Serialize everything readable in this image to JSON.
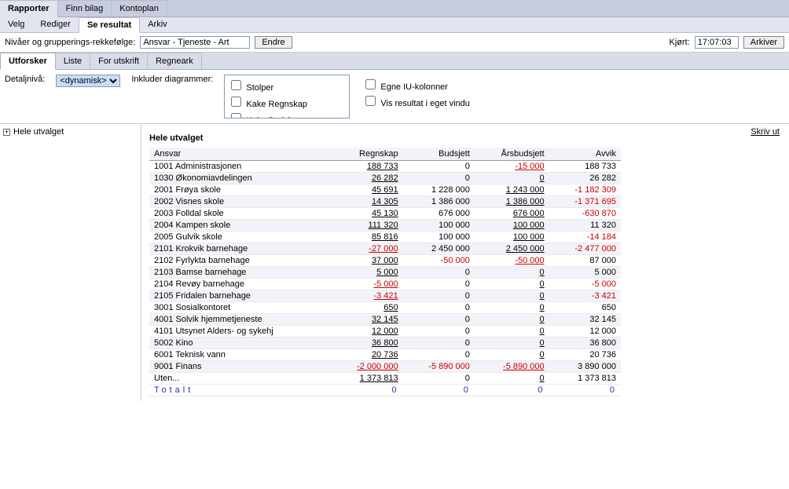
{
  "tabs1": {
    "rapporter": "Rapporter",
    "finnbilag": "Finn bilag",
    "kontoplan": "Kontoplan"
  },
  "tabs2": {
    "velg": "Velg",
    "rediger": "Rediger",
    "seresultat": "Se resultat",
    "arkiv": "Arkiv"
  },
  "toolbar": {
    "label": "Nivåer og grupperings-rekkefølge:",
    "value": "Ansvar - Tjeneste - Art",
    "endre": "Endre",
    "kjort": "Kjørt:",
    "time": "17:07:03",
    "arkiver": "Arkiver"
  },
  "tabs3": {
    "utforsker": "Utforsker",
    "liste": "Liste",
    "forutskrift": "For utskrift",
    "regneark": "Regneark"
  },
  "options": {
    "detaljniva": "Detaljnivå:",
    "dynamisk": "<dynamisk>",
    "inkluder": "Inkluder diagrammer:",
    "stolper": "Stolper",
    "kakeRegnskap": "Kake Regnskap",
    "kakeBudsjett": "Kake Budsjett",
    "egne": "Egne IU-kolonner",
    "vis": "Vis resultat i eget vindu"
  },
  "tree": {
    "hele": "Hele utvalget"
  },
  "print": "Skriv ut",
  "section": "Hele utvalget",
  "columns": {
    "ansvar": "Ansvar",
    "regnskap": "Regnskap",
    "budsjett": "Budsjett",
    "aarsbudsjett": "Årsbudsjett",
    "avvik": "Avvik"
  },
  "rows": [
    {
      "ansvar": "1001 Administrasjonen",
      "regnskap": "188 733",
      "rneg": false,
      "budsjett": "0",
      "aars": "-15 000",
      "aneg": true,
      "avvik": "188 733",
      "vneg": false
    },
    {
      "ansvar": "1030 Økonomiavdelingen",
      "regnskap": "26 282",
      "rneg": false,
      "budsjett": "0",
      "aars": "0",
      "aneg": false,
      "avvik": "26 282",
      "vneg": false
    },
    {
      "ansvar": "2001 Frøya skole",
      "regnskap": "45 691",
      "rneg": false,
      "budsjett": "1 228 000",
      "aars": "1 243 000",
      "aneg": false,
      "avvik": "-1 182 309",
      "vneg": true
    },
    {
      "ansvar": "2002 Visnes skole",
      "regnskap": "14 305",
      "rneg": false,
      "budsjett": "1 386 000",
      "aars": "1 386 000",
      "aneg": false,
      "avvik": "-1 371 695",
      "vneg": true
    },
    {
      "ansvar": "2003 Folldal skole",
      "regnskap": "45 130",
      "rneg": false,
      "budsjett": "676 000",
      "aars": "676 000",
      "aneg": false,
      "avvik": "-630 870",
      "vneg": true
    },
    {
      "ansvar": "2004 Kampen skole",
      "regnskap": "111 320",
      "rneg": false,
      "budsjett": "100 000",
      "aars": "100 000",
      "aneg": false,
      "avvik": "11 320",
      "vneg": false
    },
    {
      "ansvar": "2005 Gulvik skole",
      "regnskap": "85 816",
      "rneg": false,
      "budsjett": "100 000",
      "aars": "100 000",
      "aneg": false,
      "avvik": "-14 184",
      "vneg": true
    },
    {
      "ansvar": "2101 Krokvik barnehage",
      "regnskap": "-27 000",
      "rneg": true,
      "budsjett": "2 450 000",
      "aars": "2 450 000",
      "aneg": false,
      "avvik": "-2 477 000",
      "vneg": true
    },
    {
      "ansvar": "2102 Fyrlykta barnehage",
      "regnskap": "37 000",
      "rneg": false,
      "budsjett": "-50 000",
      "bneg": true,
      "aars": "-50 000",
      "aneg": true,
      "avvik": "87 000",
      "vneg": false
    },
    {
      "ansvar": "2103 Bamse barnehage",
      "regnskap": "5 000",
      "rneg": false,
      "budsjett": "0",
      "aars": "0",
      "aneg": false,
      "avvik": "5 000",
      "vneg": false
    },
    {
      "ansvar": "2104 Revøy barnehage",
      "regnskap": "-5 000",
      "rneg": true,
      "budsjett": "0",
      "aars": "0",
      "aneg": false,
      "avvik": "-5 000",
      "vneg": true
    },
    {
      "ansvar": "2105 Fridalen barnehage",
      "regnskap": "-3 421",
      "rneg": true,
      "budsjett": "0",
      "aars": "0",
      "aneg": false,
      "avvik": "-3 421",
      "vneg": true
    },
    {
      "ansvar": "3001 Sosialkontoret",
      "regnskap": "650",
      "rneg": false,
      "budsjett": "0",
      "aars": "0",
      "aneg": false,
      "avvik": "650",
      "vneg": false
    },
    {
      "ansvar": "4001 Solvik hjemmetjeneste",
      "regnskap": "32 145",
      "rneg": false,
      "budsjett": "0",
      "aars": "0",
      "aneg": false,
      "avvik": "32 145",
      "vneg": false
    },
    {
      "ansvar": "4101 Utsynet Alders- og sykehj",
      "regnskap": "12 000",
      "rneg": false,
      "budsjett": "0",
      "aars": "0",
      "aneg": false,
      "avvik": "12 000",
      "vneg": false
    },
    {
      "ansvar": "5002 Kino",
      "regnskap": "36 800",
      "rneg": false,
      "budsjett": "0",
      "aars": "0",
      "aneg": false,
      "avvik": "36 800",
      "vneg": false
    },
    {
      "ansvar": "6001 Teknisk vann",
      "regnskap": "20 736",
      "rneg": false,
      "budsjett": "0",
      "aars": "0",
      "aneg": false,
      "avvik": "20 736",
      "vneg": false
    },
    {
      "ansvar": "9001 Finans",
      "regnskap": "-2 000 000",
      "rneg": true,
      "budsjett": "-5 890 000",
      "bneg": true,
      "aars": "-5 890 000",
      "aneg": true,
      "avvik": "3 890 000",
      "vneg": false
    },
    {
      "ansvar": "Uten...",
      "regnskap": "1 373 813",
      "rneg": false,
      "budsjett": "0",
      "aars": "0",
      "aneg": false,
      "avvik": "1 373 813",
      "vneg": false
    }
  ],
  "total": {
    "label": "Totalt",
    "regnskap": "0",
    "budsjett": "0",
    "aars": "0",
    "avvik": "0"
  }
}
